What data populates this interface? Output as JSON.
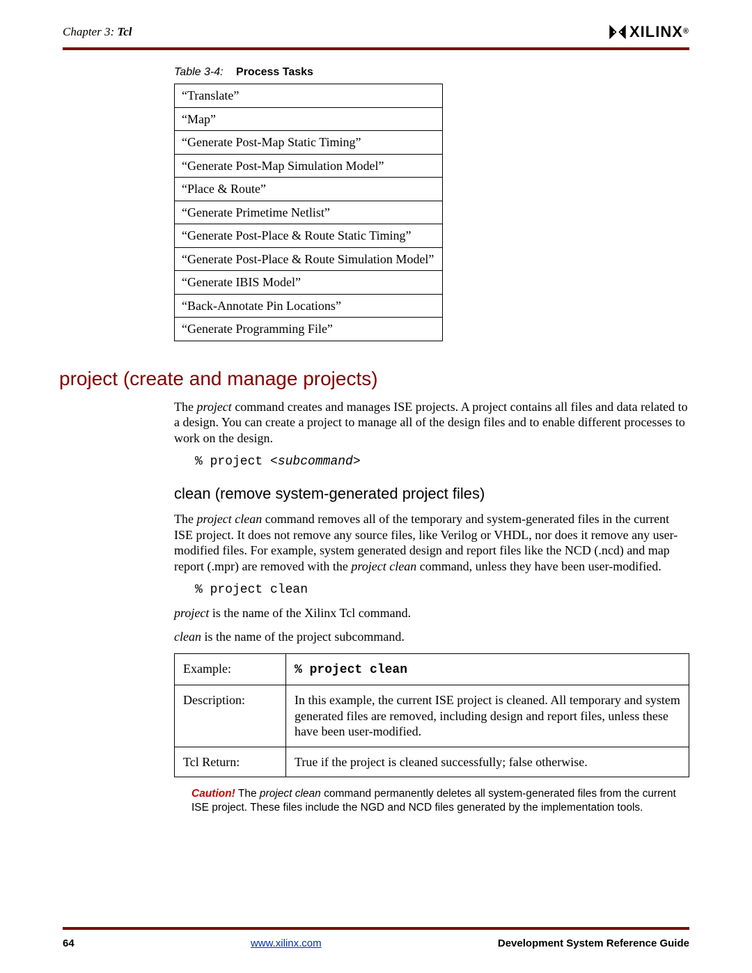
{
  "header": {
    "chapter_prefix": "Chapter 3:",
    "chapter_name": "Tcl"
  },
  "table": {
    "caption_label": "Table 3-4:",
    "caption_title": "Process Tasks",
    "rows": [
      "“Translate”",
      "“Map”",
      "“Generate Post-Map Static Timing”",
      "“Generate Post-Map Simulation Model”",
      "“Place & Route”",
      "“Generate Primetime Netlist”",
      "“Generate Post-Place & Route Static Timing”",
      "“Generate Post-Place & Route Simulation Model”",
      "“Generate IBIS Model”",
      "“Back-Annotate Pin Locations”",
      "“Generate Programming File”"
    ]
  },
  "section": {
    "title": "project (create and manage projects)",
    "intro_pre": "The ",
    "intro_em": "project",
    "intro_post": " command creates and manages ISE projects. A project contains all files and data related to a design. You can create a project to manage all of the design files and to enable different processes to work on the design.",
    "syntax_prefix": "% project <",
    "syntax_em": "subcommand",
    "syntax_suffix": ">"
  },
  "sub": {
    "title": "clean (remove system-generated project files)",
    "p1_pre": "The ",
    "p1_em1": "project clean",
    "p1_mid": " command removes all of the temporary and system-generated files in the current ISE project. It does not remove any source files, like Verilog or VHDL, nor does it remove any user-modified files. For example, system generated design and report files like the NCD (.ncd) and map report (.mpr) are removed with the ",
    "p1_em2": "project clean",
    "p1_post": " command, unless they have been user-modified.",
    "code": "% project clean",
    "p2_em": "project",
    "p2_rest": " is the name of the Xilinx Tcl command.",
    "p3_em": "clean",
    "p3_rest": " is the name of the project subcommand."
  },
  "cmd_table": {
    "example_label": "Example:",
    "example_code": "% project clean",
    "desc_label": "Description:",
    "desc_text": "In this example, the current ISE project is cleaned. All temporary and system generated files are removed, including design and report files, unless these have been user-modified.",
    "ret_label": "Tcl Return:",
    "ret_text": "True if the project is cleaned successfully; false otherwise."
  },
  "caution": {
    "label": "Caution!",
    "text_pre": "  The ",
    "text_em": "project clean",
    "text_post": " command permanently deletes all system-generated files from the current ISE project. These files include the NGD and NCD files generated by the implementation tools."
  },
  "footer": {
    "page": "64",
    "link": "www.xilinx.com",
    "guide": "Development System Reference Guide"
  },
  "logo": {
    "text": "XILINX",
    "reg": "®"
  }
}
